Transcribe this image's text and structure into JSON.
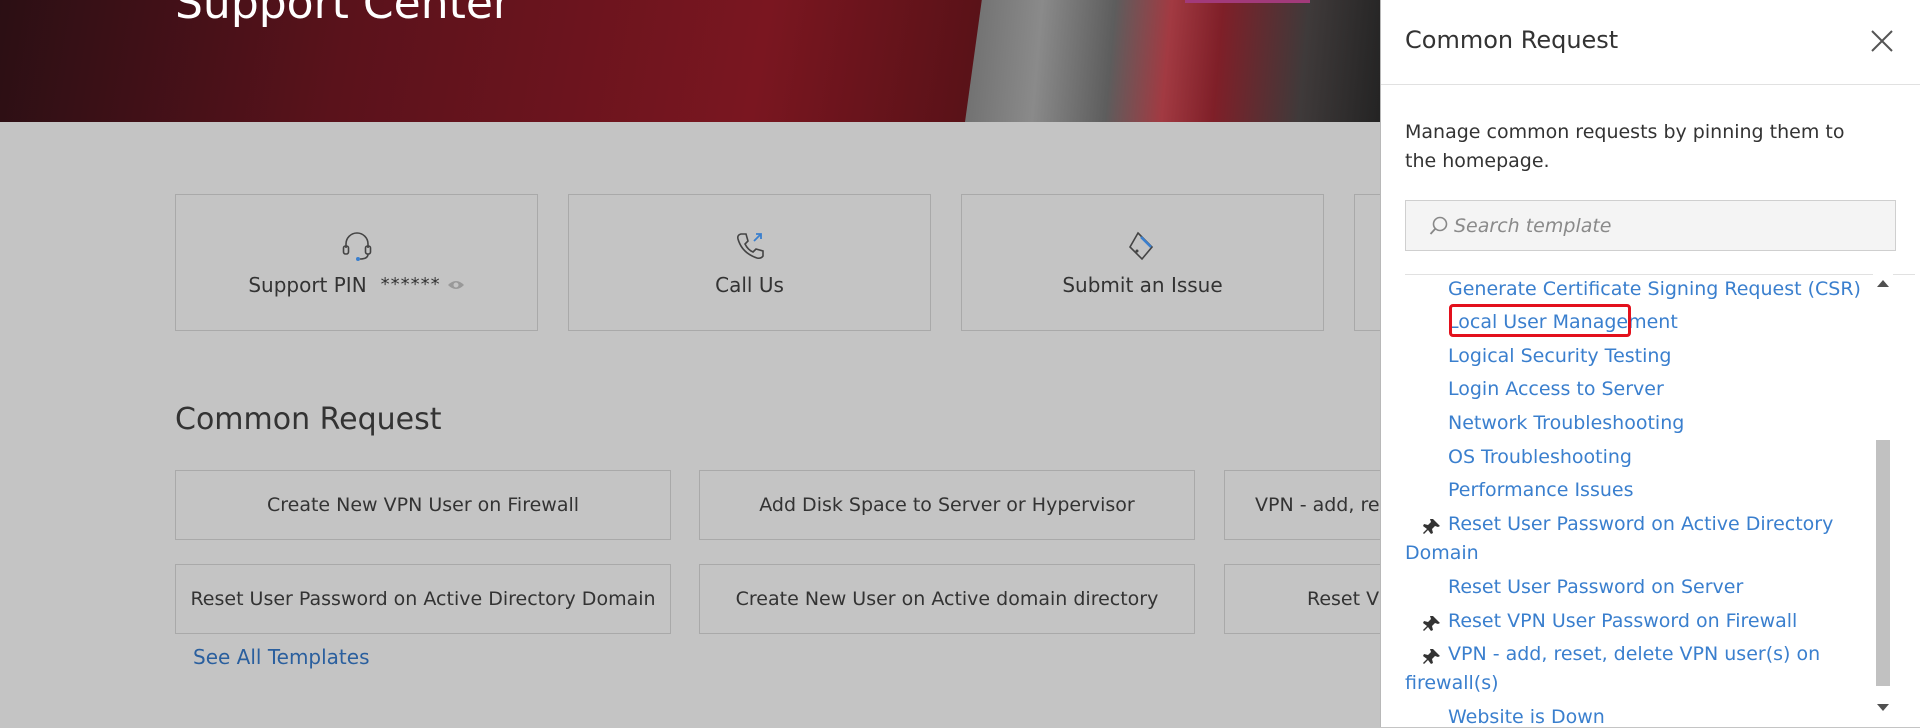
{
  "hero": {
    "title": "Support Center"
  },
  "tiles": [
    {
      "label": "Support PIN",
      "value": "******",
      "icon": "headset-icon"
    },
    {
      "label": "Call Us",
      "icon": "phone-icon"
    },
    {
      "label": "Submit an Issue",
      "icon": "ticket-icon"
    }
  ],
  "common": {
    "title": "Common Request",
    "requests": [
      "Create New VPN User on Firewall",
      "Add Disk Space to Server or Hypervisor",
      "VPN - add, res",
      "Reset User Password on Active Directory Domain",
      "Create New User on Active domain directory",
      "Reset VP"
    ],
    "see_all": "See All Templates"
  },
  "panel": {
    "title": "Common Request",
    "description": "Manage common requests by pinning them to the homepage.",
    "search_placeholder": "Search template",
    "items": [
      {
        "label": "Generate Certificate Signing Request (CSR)",
        "pinned": false
      },
      {
        "label": "Local User Management",
        "pinned": false,
        "highlighted": true
      },
      {
        "label": "Logical Security Testing",
        "pinned": false
      },
      {
        "label": "Login Access to Server",
        "pinned": false
      },
      {
        "label": "Network Troubleshooting",
        "pinned": false
      },
      {
        "label": "OS Troubleshooting",
        "pinned": false
      },
      {
        "label": "Performance Issues",
        "pinned": false
      },
      {
        "label": "Reset User Password on Active Directory Domain",
        "pinned": true
      },
      {
        "label": "Reset User Password on Server",
        "pinned": false
      },
      {
        "label": "Reset VPN User Password on Firewall",
        "pinned": true
      },
      {
        "label": "VPN - add, reset, delete VPN user(s) on firewall(s)",
        "pinned": true
      },
      {
        "label": "Website is Down",
        "pinned": false
      }
    ]
  },
  "colors": {
    "link": "#3a7fce",
    "highlight": "#e3101c",
    "brand": "#7a1620"
  }
}
